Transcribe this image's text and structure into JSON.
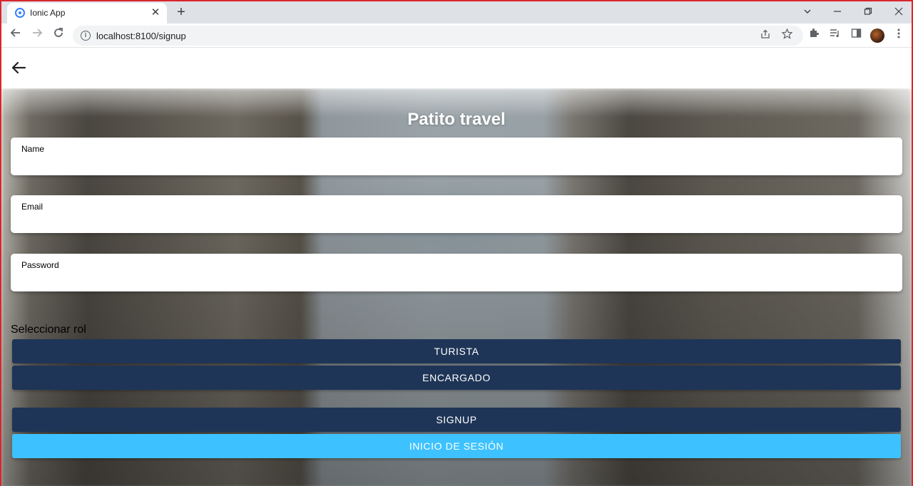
{
  "browser": {
    "tab_title": "Ionic App",
    "tab_close": "✕",
    "new_tab": "+",
    "url": "localhost:8100/signup",
    "info": "i"
  },
  "page": {
    "title": "Patito travel",
    "fields": {
      "name_label": "Name",
      "email_label": "Email",
      "password_label": "Password"
    },
    "rol_label": "Seleccionar rol",
    "buttons": {
      "turista": "TURISTA",
      "encargado": "ENCARGADO",
      "signup": "SIGNUP",
      "login": "INICIO DE SESIÓN"
    }
  },
  "colors": {
    "primary_dark": "#1e3557",
    "primary_light": "#3dc2ff",
    "window_border": "#d9262b"
  }
}
